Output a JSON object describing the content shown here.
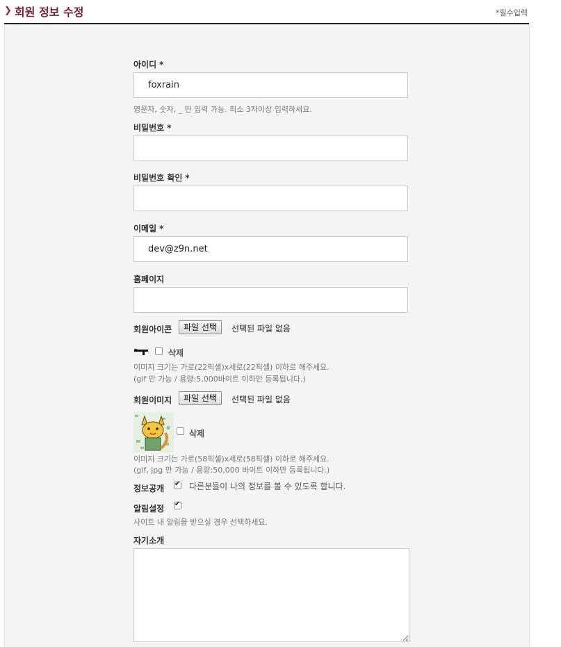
{
  "header": {
    "title": "회원 정보 수정",
    "required_note": "*필수입력"
  },
  "form": {
    "id": {
      "label": "아이디",
      "star": "*",
      "value": "foxrain",
      "help": "영문자, 숫자, _ 만 입력 가능. 최소 3자이상 입력하세요."
    },
    "password": {
      "label": "비밀번호",
      "star": "*",
      "value": ""
    },
    "password_confirm": {
      "label": "비밀번호 확인",
      "star": "*",
      "value": ""
    },
    "email": {
      "label": "이메일",
      "star": "*",
      "value": "dev@z9n.net"
    },
    "homepage": {
      "label": "홈페이지",
      "value": ""
    },
    "member_icon": {
      "label": "회원아이콘",
      "file_button": "파일 선택",
      "file_status": "선택된 파일 없음",
      "delete_label": "삭제",
      "help1": "이미지 크기는 가로(22픽셀)x세로(22픽셀) 이하로 해주세요.",
      "help2": "(gif 만 가능 / 용량:5,000바이트 이하만 등록됩니다.)"
    },
    "member_image": {
      "label": "회원이미지",
      "file_button": "파일 선택",
      "file_status": "선택된 파일 없음",
      "delete_label": "삭제",
      "help1": "이미지 크기는 가로(58픽셀)x세로(58픽셀) 이하로 해주세요.",
      "help2": "(gif, jpg 만 가능 / 용량:50,000 바이트 이하만 등록됩니다.)"
    },
    "info_public": {
      "label": "정보공개",
      "checked": true,
      "text": "다른분들이 나의 정보를 볼 수 있도록 합니다."
    },
    "notification": {
      "label": "알림설정",
      "checked": true,
      "help": "사이트 내 알림을 받으실 경우 선택하세요."
    },
    "intro": {
      "label": "자기소개",
      "value": ""
    }
  }
}
